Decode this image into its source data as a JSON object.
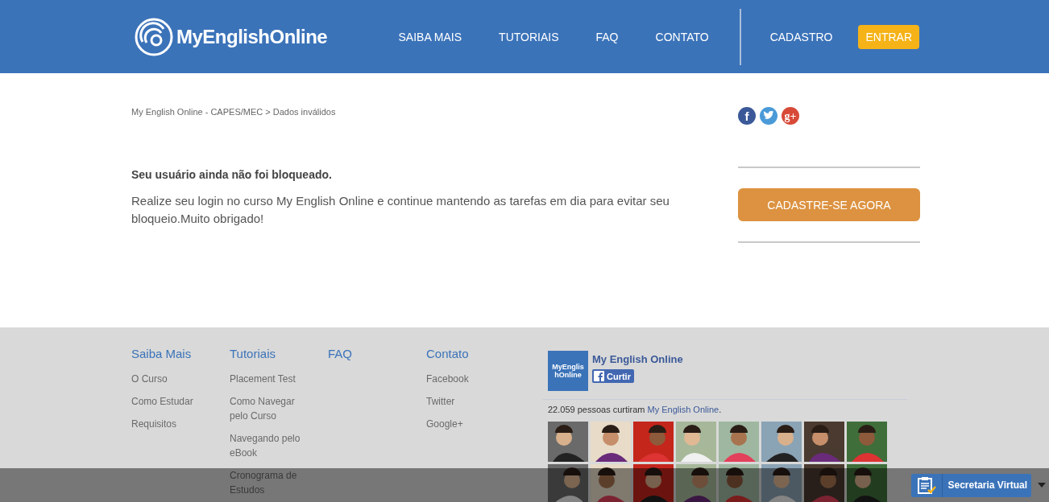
{
  "header": {
    "logo": "MyEnglishOnline",
    "nav": [
      {
        "label": "SAIBA MAIS"
      },
      {
        "label": "TUTORIAIS"
      },
      {
        "label": "FAQ"
      },
      {
        "label": "CONTATO"
      }
    ],
    "signup": "CADASTRO",
    "login": "ENTRAR"
  },
  "breadcrumb": "My English Online - CAPES/MEC > Dados inválidos",
  "social": [
    {
      "kind": "facebook",
      "glyph": "f"
    },
    {
      "kind": "twitter"
    },
    {
      "kind": "google",
      "glyph": "g+"
    }
  ],
  "message": {
    "title": "Seu usuário ainda não foi bloqueado.",
    "body": "Realize seu login no curso My English Online e continue mantendo as tarefas em dia para evitar seu bloqueio.Muito obrigado!"
  },
  "cta": "CADASTRE-SE AGORA",
  "footer_columns": [
    {
      "title": "Saiba Mais",
      "links": [
        "O Curso",
        "Como Estudar",
        "Requisitos"
      ]
    },
    {
      "title": "Tutoriais",
      "links": [
        "Placement Test",
        "Como Navegar pelo Curso",
        "Navegando pelo eBook",
        "Cronograma de Estudos"
      ]
    },
    {
      "title": "FAQ"
    },
    {
      "title": "Contato",
      "links": [
        "Facebook",
        "Twitter",
        "Google+"
      ]
    }
  ],
  "facebook_widget": {
    "page_name": "My English Online",
    "thumb_text": "MyEnglishOnline",
    "like_button": "Curtir",
    "count_text": "22.059 pessoas curtiram ",
    "count_link": "My English Online",
    "count_end": "."
  },
  "bottom_bar": {
    "button": "Secretaria Virtual"
  }
}
